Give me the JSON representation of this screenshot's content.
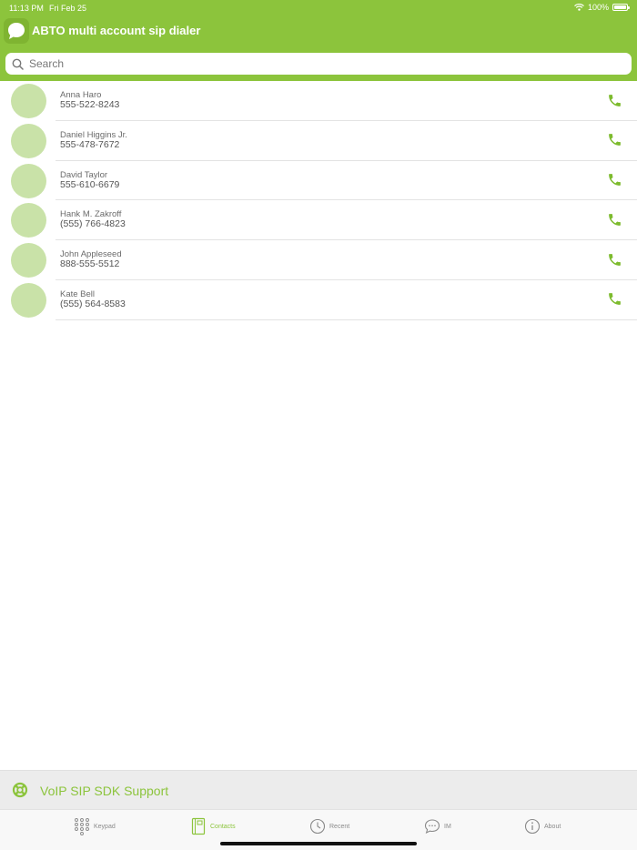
{
  "status_bar": {
    "time": "11:13 PM",
    "date": "Fri Feb 25",
    "battery": "100%"
  },
  "header": {
    "title": "ABTO multi account sip dialer",
    "icon": "chat-bubble-icon"
  },
  "search": {
    "placeholder": "Search",
    "value": ""
  },
  "contacts": [
    {
      "name": "Anna Haro",
      "phone": "555-522-8243"
    },
    {
      "name": "Daniel Higgins Jr.",
      "phone": "555-478-7672"
    },
    {
      "name": "David Taylor",
      "phone": "555-610-6679"
    },
    {
      "name": "Hank M. Zakroff",
      "phone": "(555) 766-4823"
    },
    {
      "name": "John Appleseed",
      "phone": "888-555-5512"
    },
    {
      "name": "Kate Bell",
      "phone": "(555) 564-8583"
    }
  ],
  "support": {
    "label": "VoIP SIP SDK Support",
    "icon": "lifebuoy-icon"
  },
  "tabs": [
    {
      "label": "Keypad",
      "icon": "keypad-icon",
      "active": false
    },
    {
      "label": "Contacts",
      "icon": "contacts-book-icon",
      "active": true
    },
    {
      "label": "Recent",
      "icon": "clock-icon",
      "active": false
    },
    {
      "label": "IM",
      "icon": "chat-bubble-icon",
      "active": false
    },
    {
      "label": "About",
      "icon": "info-icon",
      "active": false
    }
  ],
  "colors": {
    "accent": "#8cc43c",
    "avatar": "#c9e2a8",
    "support_bar": "#ececec"
  }
}
